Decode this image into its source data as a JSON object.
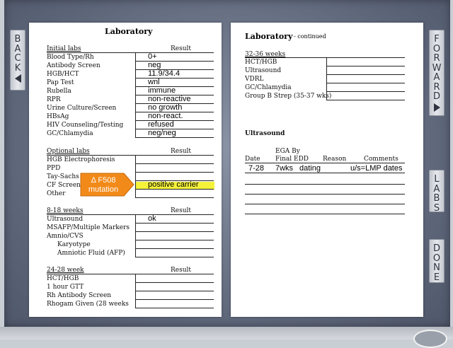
{
  "nav": {
    "back": [
      "B",
      "A",
      "C",
      "K"
    ],
    "forward": [
      "F",
      "O",
      "R",
      "W",
      "A",
      "R",
      "D"
    ],
    "labs": [
      "L",
      "A",
      "B",
      "S"
    ],
    "done": [
      "D",
      "O",
      "N",
      "E"
    ]
  },
  "left": {
    "title": "Laboratory",
    "initial": {
      "heading": "Initial labs",
      "result_header": "Result",
      "rows": [
        {
          "label": "Blood Type/Rh",
          "value": "0+"
        },
        {
          "label": "Antibody Screen",
          "value": "neg"
        },
        {
          "label": "HGB/HCT",
          "value": "11.9/34.4"
        },
        {
          "label": "Pap Test",
          "value": "wnl"
        },
        {
          "label": "Rubella",
          "value": "immune"
        },
        {
          "label": "RPR",
          "value": "non-reactive"
        },
        {
          "label": "Urine Culture/Screen",
          "value": "no growth"
        },
        {
          "label": "HBsAg",
          "value": "non-react."
        },
        {
          "label": "HIV Counseling/Testing",
          "value": "refused"
        },
        {
          "label": "GC/Chlamydia",
          "value": "neg/neg"
        }
      ]
    },
    "optional": {
      "heading": "Optional labs",
      "result_header": "Result",
      "rows": [
        {
          "label": "HGB Electrophoresis",
          "value": ""
        },
        {
          "label": "PPD",
          "value": ""
        },
        {
          "label": "Tay-Sachs",
          "value": ""
        },
        {
          "label": "CF Screen",
          "value": "positive carrier"
        },
        {
          "label": "Other",
          "value": ""
        }
      ],
      "callout": [
        "Δ F508",
        "mutation"
      ]
    },
    "weeks_8_18": {
      "heading": "8-18 weeks",
      "result_header": "Result",
      "rows": [
        {
          "label": "Ultrasound",
          "value": "ok"
        },
        {
          "label": "MSAFP/Multiple Markers",
          "value": ""
        },
        {
          "label": "Amnio/CVS",
          "value": ""
        },
        {
          "label": "Karyotype",
          "value": ""
        },
        {
          "label": "Amniotic Fluid (AFP)",
          "value": ""
        }
      ]
    },
    "weeks_24_28": {
      "heading": "24-28 week",
      "result_header": "Result",
      "rows": [
        {
          "label": "HCT/HGB",
          "value": ""
        },
        {
          "label": "1 hour GTT",
          "value": ""
        },
        {
          "label": "Rh Antibody Screen",
          "value": ""
        },
        {
          "label": "Rhogam Given (28 weeks",
          "value": ""
        }
      ]
    }
  },
  "right": {
    "title": "Laboratory",
    "title_suffix": "- continued",
    "weeks_32_36": {
      "heading": "32-36 weeks",
      "rows": [
        {
          "label": "HCT/HGB",
          "value": ""
        },
        {
          "label": "Ultrasound",
          "value": ""
        },
        {
          "label": "VDRL",
          "value": ""
        },
        {
          "label": "GC/Chlamydia",
          "value": ""
        },
        {
          "label": "Group B Strep (35-37 wks)",
          "value": ""
        }
      ]
    },
    "ultrasound": {
      "heading": "Ultrasound",
      "col_date": "Date",
      "col_ega_line1": "EGA By",
      "col_ega_line2": "Final EDD",
      "col_reason": "Reason",
      "col_comments": "Comments",
      "rows": [
        {
          "date": "7-28",
          "ega": "7wks",
          "reason": "dating",
          "comments": "u/s=LMP dates"
        }
      ]
    }
  }
}
